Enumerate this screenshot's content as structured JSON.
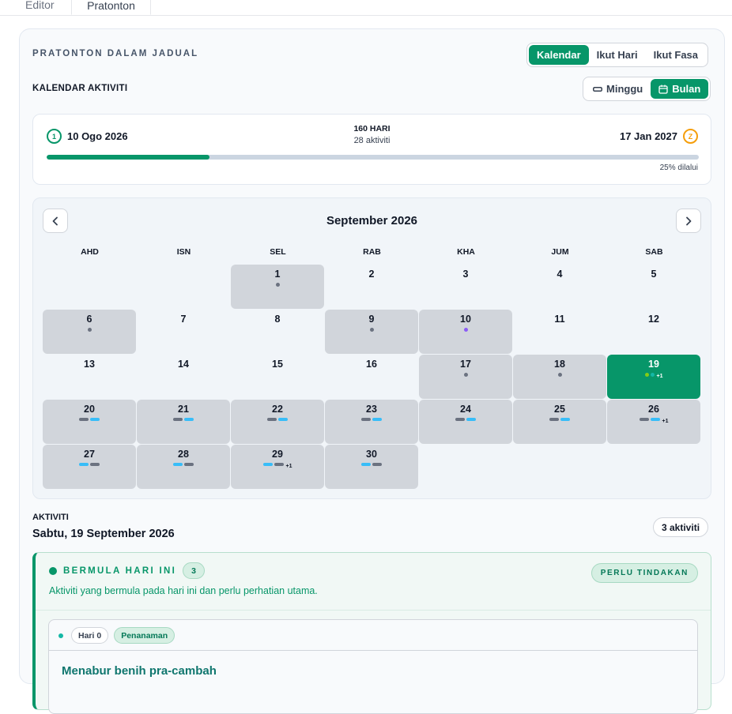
{
  "tabs": {
    "editor": "Editor",
    "preview": "Pratonton"
  },
  "header": {
    "section_title": "PRATONTON DALAM JADUAL"
  },
  "view_modes": [
    {
      "label": "Kalendar",
      "active": true
    },
    {
      "label": "Ikut Hari",
      "active": false
    },
    {
      "label": "Ikut Fasa",
      "active": false
    }
  ],
  "calendar_header": {
    "title": "KALENDAR AKTIVITI",
    "week_label": "Minggu",
    "month_label": "Bulan",
    "active": "month"
  },
  "timeline": {
    "start_marker": "1",
    "start_date": "10 Ogo 2026",
    "end_marker": "Z",
    "end_date": "17 Jan 2027",
    "days_label": "160 HARI",
    "activities_label": "28 aktiviti",
    "progress": 0.25,
    "progress_label": "25% dilalui"
  },
  "calendar": {
    "month_label": "September 2026",
    "weekdays": [
      "AHD",
      "ISN",
      "SEL",
      "RAB",
      "KHA",
      "JUM",
      "SAB"
    ],
    "first_weekday": 2,
    "selected_day": 19,
    "days": [
      {
        "n": 1,
        "marks": [
          {
            "t": "dot",
            "c": "#6b7280"
          }
        ]
      },
      {
        "n": 2,
        "marks": []
      },
      {
        "n": 3,
        "marks": []
      },
      {
        "n": 4,
        "marks": []
      },
      {
        "n": 5,
        "marks": []
      },
      {
        "n": 6,
        "marks": [
          {
            "t": "dot",
            "c": "#6b7280"
          }
        ]
      },
      {
        "n": 7,
        "marks": []
      },
      {
        "n": 8,
        "marks": []
      },
      {
        "n": 9,
        "marks": [
          {
            "t": "dot",
            "c": "#6b7280"
          }
        ]
      },
      {
        "n": 10,
        "marks": [
          {
            "t": "dot",
            "c": "#8b5cf6"
          }
        ]
      },
      {
        "n": 11,
        "marks": []
      },
      {
        "n": 12,
        "marks": []
      },
      {
        "n": 13,
        "marks": []
      },
      {
        "n": 14,
        "marks": []
      },
      {
        "n": 15,
        "marks": []
      },
      {
        "n": 16,
        "marks": []
      },
      {
        "n": 17,
        "marks": [
          {
            "t": "dot",
            "c": "#6b7280"
          }
        ]
      },
      {
        "n": 18,
        "marks": [
          {
            "t": "dot",
            "c": "#6b7280"
          }
        ]
      },
      {
        "n": 19,
        "marks": [
          {
            "t": "dot",
            "c": "#84cc16"
          },
          {
            "t": "dot",
            "c": "#14b8a6"
          }
        ],
        "more": "+1"
      },
      {
        "n": 20,
        "marks": [
          {
            "t": "dash",
            "c": "#6b7280"
          },
          {
            "t": "dash",
            "c": "#38bdf8"
          }
        ]
      },
      {
        "n": 21,
        "marks": [
          {
            "t": "dash",
            "c": "#6b7280"
          },
          {
            "t": "dash",
            "c": "#38bdf8"
          }
        ]
      },
      {
        "n": 22,
        "marks": [
          {
            "t": "dash",
            "c": "#6b7280"
          },
          {
            "t": "dash",
            "c": "#38bdf8"
          }
        ]
      },
      {
        "n": 23,
        "marks": [
          {
            "t": "dash",
            "c": "#6b7280"
          },
          {
            "t": "dash",
            "c": "#38bdf8"
          }
        ]
      },
      {
        "n": 24,
        "marks": [
          {
            "t": "dash",
            "c": "#6b7280"
          },
          {
            "t": "dash",
            "c": "#38bdf8"
          }
        ]
      },
      {
        "n": 25,
        "marks": [
          {
            "t": "dash",
            "c": "#6b7280"
          },
          {
            "t": "dash",
            "c": "#38bdf8"
          }
        ]
      },
      {
        "n": 26,
        "marks": [
          {
            "t": "dash",
            "c": "#6b7280"
          },
          {
            "t": "dash",
            "c": "#38bdf8"
          }
        ],
        "more": "+1"
      },
      {
        "n": 27,
        "marks": [
          {
            "t": "dash",
            "c": "#38bdf8"
          },
          {
            "t": "dash",
            "c": "#6b7280"
          }
        ]
      },
      {
        "n": 28,
        "marks": [
          {
            "t": "dash",
            "c": "#38bdf8"
          },
          {
            "t": "dash",
            "c": "#6b7280"
          }
        ]
      },
      {
        "n": 29,
        "marks": [
          {
            "t": "dash",
            "c": "#38bdf8"
          },
          {
            "t": "dash",
            "c": "#6b7280"
          }
        ],
        "more": "+1"
      },
      {
        "n": 30,
        "marks": [
          {
            "t": "dash",
            "c": "#38bdf8"
          },
          {
            "t": "dash",
            "c": "#6b7280"
          }
        ]
      }
    ]
  },
  "activities": {
    "label": "AKTIVITI",
    "date": "Sabtu, 19 September 2026",
    "count_label": "3 aktiviti",
    "group": {
      "title": "BERMULA HARI INI",
      "count": "3",
      "tag": "PERLU TINDAKAN",
      "description": "Aktiviti yang bermula pada hari ini dan perlu perhatian utama.",
      "item": {
        "day_chip": "Hari 0",
        "phase_chip": "Penanaman",
        "title": "Menabur benih pra-cambah"
      }
    }
  },
  "colors": {
    "accent": "#079669",
    "warning": "#f59e0b",
    "cell_active": "#d1d5db"
  }
}
